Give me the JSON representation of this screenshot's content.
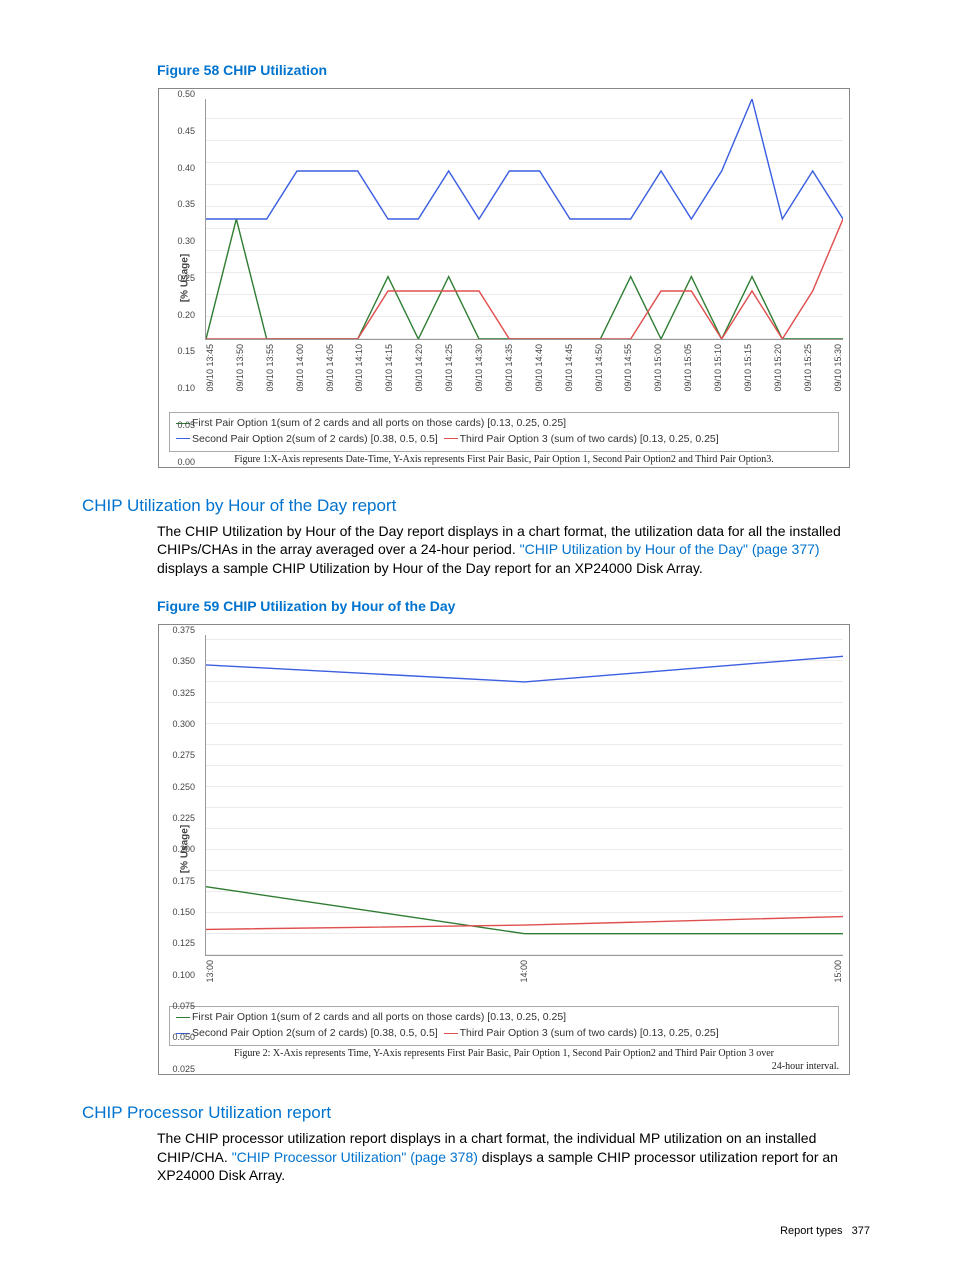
{
  "figure58": {
    "title": "Figure 58 CHIP Utilization",
    "caption": "Figure 1:X-Axis represents Date-Time, Y-Axis represents First Pair Basic, Pair Option 1, Second Pair Option2 and Third Pair Option3."
  },
  "section1": {
    "title": "CHIP Utilization by Hour of the Day report",
    "body_pre": "The CHIP Utilization by Hour of the Day report displays in a chart format, the utilization data for all the installed CHIPs/CHAs in the array averaged over a 24-hour period. ",
    "link": "\"CHIP Utilization by Hour of the Day\" (page 377)",
    "body_post": " displays a sample CHIP Utilization by Hour of the Day report for an XP24000 Disk Array."
  },
  "figure59": {
    "title": "Figure 59 CHIP Utilization by Hour of the Day",
    "caption1": "Figure 2: X-Axis represents Time, Y-Axis represents First Pair Basic, Pair Option 1, Second Pair Option2 and Third Pair Option 3 over",
    "caption2": "24-hour interval."
  },
  "section2": {
    "title": "CHIP Processor Utilization report",
    "body_pre": "The CHIP processor utilization report displays in a chart format, the individual MP utilization on an installed CHIP/CHA. ",
    "link": "\"CHIP Processor Utilization\" (page 378)",
    "body_post": " displays a sample CHIP processor utilization report for an XP24000 Disk Array."
  },
  "legend": {
    "s1": "First Pair Option 1(sum of 2 cards and all ports on those cards) [0.13, 0.25, 0.25]",
    "s2": "Second Pair Option 2(sum of 2 cards) [0.38, 0.5, 0.5]",
    "s3": "Third Pair Option 3 (sum of two cards) [0.13, 0.25, 0.25]"
  },
  "axis": {
    "ylabel": "[% Usage]"
  },
  "footer": {
    "label": "Report types",
    "page": "377"
  },
  "chart_data": [
    {
      "type": "line",
      "title": "CHIP Utilization",
      "ylabel": "[% Usage]",
      "ylim": [
        0.0,
        0.5
      ],
      "yticks": [
        "0.00",
        "0.05",
        "0.10",
        "0.15",
        "0.20",
        "0.25",
        "0.30",
        "0.35",
        "0.40",
        "0.45",
        "0.50"
      ],
      "categories": [
        "09/10 13:45",
        "09/10 13:50",
        "09/10 13:55",
        "09/10 14:00",
        "09/10 14:05",
        "09/10 14:10",
        "09/10 14:15",
        "09/10 14:20",
        "09/10 14:25",
        "09/10 14:30",
        "09/10 14:35",
        "09/10 14:40",
        "09/10 14:45",
        "09/10 14:50",
        "09/10 14:55",
        "09/10 15:00",
        "09/10 15:05",
        "09/10 15:10",
        "09/10 15:15",
        "09/10 15:20",
        "09/10 15:25",
        "09/10 15:30"
      ],
      "series": [
        {
          "name": "First Pair Option 1(sum of 2 cards and all ports on those cards) [0.13, 0.25, 0.25]",
          "color": "#2e7d32",
          "values": [
            0.0,
            0.25,
            0.0,
            0.0,
            0.0,
            0.0,
            0.13,
            0.0,
            0.13,
            0.0,
            0.0,
            0.0,
            0.0,
            0.0,
            0.13,
            0.0,
            0.13,
            0.0,
            0.13,
            0.0,
            0.0,
            0.0
          ]
        },
        {
          "name": "Second Pair Option 2(sum of 2 cards) [0.38, 0.5, 0.5]",
          "color": "#3b5fe0",
          "values": [
            0.25,
            0.25,
            0.25,
            0.35,
            0.35,
            0.35,
            0.25,
            0.25,
            0.35,
            0.25,
            0.35,
            0.35,
            0.25,
            0.25,
            0.25,
            0.35,
            0.25,
            0.35,
            0.5,
            0.25,
            0.35,
            0.25
          ]
        },
        {
          "name": "Third Pair Option 3 (sum of two cards) [0.13, 0.25, 0.25]",
          "color": "#e04f4f",
          "values": [
            0.0,
            0.0,
            0.0,
            0.0,
            0.0,
            0.0,
            0.1,
            0.1,
            0.1,
            0.1,
            0.0,
            0.0,
            0.0,
            0.0,
            0.0,
            0.1,
            0.1,
            0.0,
            0.1,
            0.0,
            0.1,
            0.25
          ]
        }
      ]
    },
    {
      "type": "line",
      "title": "CHIP Utilization by Hour of the Day",
      "ylabel": "[% Usage]",
      "ylim": [
        0.0,
        0.375
      ],
      "yticks": [
        "0.025",
        "0.050",
        "0.075",
        "0.100",
        "0.125",
        "0.150",
        "0.175",
        "0.200",
        "0.225",
        "0.250",
        "0.275",
        "0.300",
        "0.325",
        "0.350",
        "0.375"
      ],
      "categories": [
        "13:00",
        "14:00",
        "15:00"
      ],
      "series": [
        {
          "name": "First Pair Option 1(sum of 2 cards and all ports on those cards) [0.13, 0.25, 0.25]",
          "color": "#2e7d32",
          "values": [
            0.08,
            0.025,
            0.025
          ]
        },
        {
          "name": "Second Pair Option 2(sum of 2 cards) [0.38, 0.5, 0.5]",
          "color": "#3b5fe0",
          "values": [
            0.34,
            0.32,
            0.35
          ]
        },
        {
          "name": "Third Pair Option 3 (sum of two cards) [0.13, 0.25, 0.25]",
          "color": "#e04f4f",
          "values": [
            0.03,
            0.035,
            0.045
          ]
        }
      ]
    }
  ]
}
